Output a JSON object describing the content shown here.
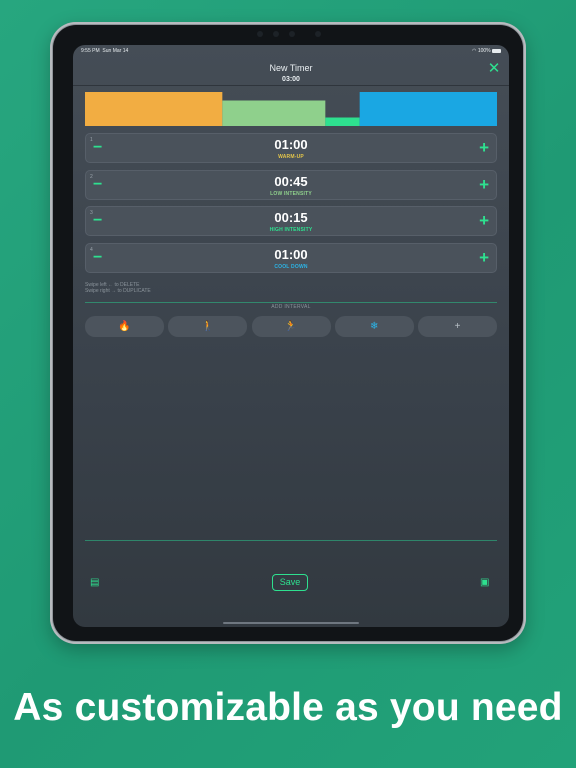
{
  "status_bar": {
    "time": "9:55 PM",
    "date": "Sun Mar 14",
    "wifi": "wifi-icon",
    "battery": "100%"
  },
  "header": {
    "title": "New Timer",
    "total": "03:00",
    "close_icon": "close-icon"
  },
  "chart_data": {
    "type": "bar",
    "categories": [
      "1",
      "2",
      "3",
      "4"
    ],
    "values": [
      60,
      45,
      15,
      60
    ],
    "colors": [
      "#f2ad42",
      "#8fd08c",
      "#2ee08f",
      "#1aa7e3"
    ],
    "intensity_levels": [
      1.0,
      0.75,
      0.25,
      1.0
    ],
    "title": "",
    "xlabel": "",
    "ylabel": ""
  },
  "intervals": [
    {
      "index": "1",
      "time": "01:00",
      "label": "WARM-UP",
      "color": "#e3c54a"
    },
    {
      "index": "2",
      "time": "00:45",
      "label": "LOW INTENSITY",
      "color": "#8fd08c"
    },
    {
      "index": "3",
      "time": "00:15",
      "label": "HIGH INTENSITY",
      "color": "#2ee08f"
    },
    {
      "index": "4",
      "time": "01:00",
      "label": "COOL DOWN",
      "color": "#2bb5e8"
    }
  ],
  "controls": {
    "minus": "−",
    "plus": "+"
  },
  "hints": {
    "swipe_left": "Swipe left ← to DELETE",
    "swipe_right": "Swipe right → to DUPLICATE"
  },
  "add_interval": {
    "label": "ADD INTERVAL",
    "buttons": [
      {
        "icon": "fire-icon",
        "glyph": "🔥",
        "color": "#f2ad42"
      },
      {
        "icon": "walk-icon",
        "glyph": "🚶",
        "color": "#a9e08f"
      },
      {
        "icon": "run-icon",
        "glyph": "🏃",
        "color": "#2ee08f"
      },
      {
        "icon": "snowflake-icon",
        "glyph": "❄",
        "color": "#2bb5e8"
      },
      {
        "icon": "plus-icon",
        "glyph": "+",
        "color": "#b8c0c7"
      }
    ]
  },
  "footer": {
    "save_label": "Save",
    "left_icon": "book-icon",
    "right_icon": "stack-icon"
  },
  "tagline": "As customizable as you need"
}
